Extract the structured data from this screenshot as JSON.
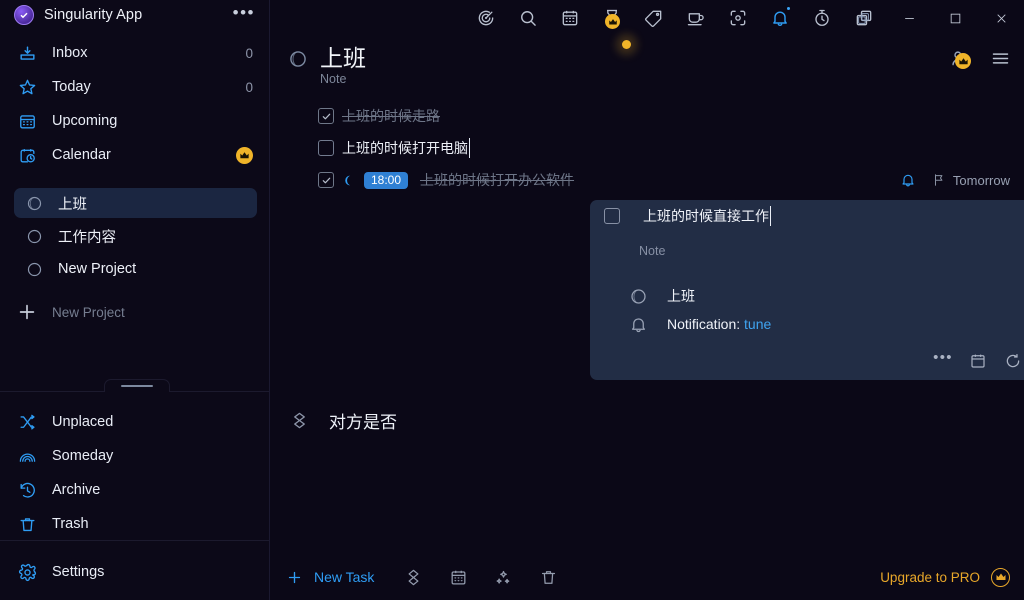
{
  "brand": {
    "name": "Singularity App",
    "logo_icon": "check-circle-logo",
    "menu_icon": "more-dots-icon"
  },
  "sidebar": {
    "nav_top": [
      {
        "label": "Inbox",
        "icon": "inbox-icon",
        "count": "0"
      },
      {
        "label": "Today",
        "icon": "star-icon",
        "count": "0"
      },
      {
        "label": "Upcoming",
        "icon": "calendar-icon",
        "count": ""
      },
      {
        "label": "Calendar",
        "icon": "clock-calendar-icon",
        "count": "",
        "badge": "crown-icon"
      }
    ],
    "projects": [
      {
        "label": "上班",
        "icon": "project-circle-icon",
        "selected": true
      },
      {
        "label": "工作内容",
        "icon": "project-circle-icon",
        "selected": false
      },
      {
        "label": "New Project",
        "icon": "project-circle-icon",
        "selected": false
      }
    ],
    "new_project": {
      "label": "New Project",
      "icon": "plus-icon"
    },
    "nav_bottom": [
      {
        "label": "Unplaced",
        "icon": "shuffle-icon"
      },
      {
        "label": "Someday",
        "icon": "rainbow-icon"
      },
      {
        "label": "Archive",
        "icon": "history-icon"
      },
      {
        "label": "Trash",
        "icon": "trash-icon"
      }
    ],
    "settings": {
      "label": "Settings",
      "icon": "gear-icon"
    },
    "resize_handle": "sidebar-resize-handle"
  },
  "titlebar": {
    "tools": [
      {
        "icon": "radar-icon",
        "state": "normal"
      },
      {
        "icon": "search-icon",
        "state": "normal"
      },
      {
        "icon": "calendar-icon",
        "state": "normal"
      },
      {
        "icon": "hourglass-icon",
        "state": "pro-crown"
      },
      {
        "icon": "tag-icon",
        "state": "normal"
      },
      {
        "icon": "coffee-cup-icon",
        "state": "normal"
      },
      {
        "icon": "focus-frame-icon",
        "state": "normal"
      },
      {
        "icon": "bell-icon",
        "state": "active-dot"
      },
      {
        "icon": "stopwatch-icon",
        "state": "normal"
      },
      {
        "icon": "duplicate-icon",
        "state": "normal"
      }
    ],
    "window_controls": [
      {
        "icon": "restore-window-icon"
      },
      {
        "icon": "minimize-icon"
      },
      {
        "icon": "maximize-icon"
      },
      {
        "icon": "close-icon"
      }
    ]
  },
  "page_header": {
    "icon": "project-circle-icon",
    "title": "上班",
    "subtitle": "Note",
    "actions": [
      {
        "icon": "add-member-icon",
        "badge": "crown-icon"
      },
      {
        "icon": "hamburger-menu-icon"
      }
    ]
  },
  "tasks": [
    {
      "text": "上班的时候走路",
      "done": true,
      "editing": false,
      "time": "",
      "moon": false,
      "bell": false,
      "flag": ""
    },
    {
      "text": "上班的时候打开电脑",
      "done": false,
      "editing": true,
      "time": "",
      "moon": false,
      "bell": false,
      "flag": ""
    },
    {
      "text": "上班的时候打开办公软件",
      "done": true,
      "editing": false,
      "time": "18:00",
      "moon": true,
      "bell": true,
      "flag": "Tomorrow"
    }
  ],
  "expanded_card": {
    "title": "上班的时候直接工作",
    "note_placeholder": "Note",
    "project": {
      "icon": "project-circle-icon",
      "label": "上班"
    },
    "notification": {
      "icon": "bell-icon",
      "label": "Notification:",
      "value": "tune"
    },
    "tools": [
      {
        "icon": "more-dots-icon"
      },
      {
        "icon": "calendar-icon"
      },
      {
        "icon": "repeat-icon"
      },
      {
        "icon": "timer-icon",
        "badge": "crown-icon"
      },
      {
        "icon": "priority-icon"
      },
      {
        "icon": "pin-icon"
      },
      {
        "icon": "flag-icon"
      },
      {
        "icon": "move-icon"
      },
      {
        "icon": "tag-icon"
      },
      {
        "icon": "subtask-list-icon"
      }
    ]
  },
  "section2": {
    "icon": "layers-diamond-icon",
    "title": "对方是否"
  },
  "bottom_bar": {
    "new_task": {
      "icon": "plus-icon",
      "label": "New Task"
    },
    "icons": [
      {
        "icon": "layers-diamond-icon"
      },
      {
        "icon": "calendar-icon"
      },
      {
        "icon": "sparkle-move-icon"
      },
      {
        "icon": "trash-icon"
      }
    ],
    "upgrade": {
      "label": "Upgrade to PRO",
      "icon": "crown-icon"
    }
  },
  "colors": {
    "background": "#0b0817",
    "sidebar": "#0c0918",
    "accent_blue": "#2f9df4",
    "gold": "#f0b429",
    "card_bg": "#222d45",
    "selected_item": "#1b2641",
    "badge_blue": "#2f80d4",
    "muted_text": "#7d8699"
  }
}
